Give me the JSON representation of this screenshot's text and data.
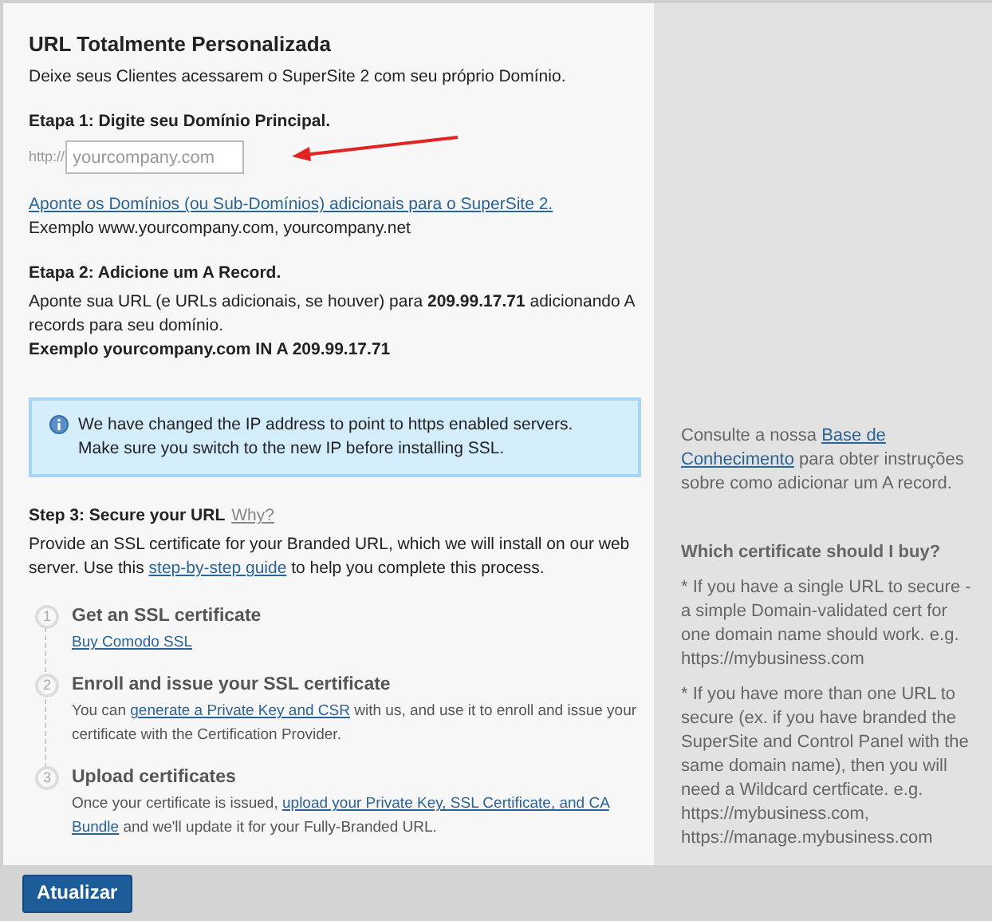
{
  "title": "URL Totalmente Personalizada",
  "subtitle": "Deixe seus Clientes acessarem o SuperSite 2 com seu próprio Domínio.",
  "step1": {
    "heading": "Etapa 1: Digite seu Domínio Principal.",
    "prefix": "http://",
    "placeholder": "yourcompany.com",
    "link": "Aponte os Domínios (ou Sub-Domínios) adicionais para o SuperSite 2.",
    "example": "Exemplo www.yourcompany.com, yourcompany.net"
  },
  "step2": {
    "heading": "Etapa 2: Adicione um A Record.",
    "text": "Aponte sua URL (e URLs adicionais, se houver) para **209.99.17.71** adicionando A records para seu domínio.",
    "example": "Exemplo yourcompany.com IN A 209.99.17.71"
  },
  "notice": [
    "We have changed the IP address to point to https enabled servers.",
    "Make sure you switch to the new IP before installing SSL."
  ],
  "step3": {
    "heading": "Step 3: Secure your URL",
    "why": "Why?",
    "text": [
      {
        "kind": "text",
        "text": "Provide an SSL certificate for your Branded URL, which we will install on our web server. Use this "
      },
      {
        "kind": "link",
        "text": "step-by-step guide"
      },
      {
        "kind": "text",
        "text": " to help you complete this process."
      }
    ]
  },
  "substeps": [
    {
      "number": "1",
      "title": "Get an SSL certificate",
      "text": [
        {
          "kind": "link",
          "text": "Buy Comodo SSL"
        }
      ]
    },
    {
      "number": "2",
      "title": "Enroll and issue your SSL certificate",
      "text": [
        {
          "kind": "text",
          "text": "You can "
        },
        {
          "kind": "link",
          "text": "generate a Private Key and CSR"
        },
        {
          "kind": "text",
          "text": " with us, and use it to enroll and issue your certificate with the Certification Provider."
        }
      ]
    },
    {
      "number": "3",
      "title": "Upload certificates",
      "text": [
        {
          "kind": "text",
          "text": "Once your certificate is issued, "
        },
        {
          "kind": "link",
          "text": "upload your Private Key, SSL Certificate, and CA"
        },
        {
          "kind": "space"
        },
        {
          "kind": "link",
          "text": "Bundle"
        },
        {
          "kind": "text",
          "text": " and we'll update it for your Fully-Branded URL."
        }
      ]
    }
  ],
  "sidebar": {
    "kb": [
      {
        "kind": "text",
        "text": "Consulte a nossa "
      },
      {
        "kind": "link",
        "text": "Base de"
      },
      {
        "kind": "space"
      },
      {
        "kind": "link",
        "text": "Conhecimento"
      },
      {
        "kind": "text",
        "text": " para obter instruções sobre como adicionar um A record."
      }
    ],
    "heading": "Which certificate should I buy?",
    "notes": [
      "* If you have a single URL to secure - a simple Domain-validated cert for one domain name should work. e.g. https://mybusiness.com",
      "* If you have more than one URL to secure (ex. if you have branded the SuperSite and Control Panel with the same domain name), then you will need a Wildcard certficate. e.g. https://mybusiness.com, https://manage.mybusiness.com"
    ]
  },
  "button": "Atualizar"
}
